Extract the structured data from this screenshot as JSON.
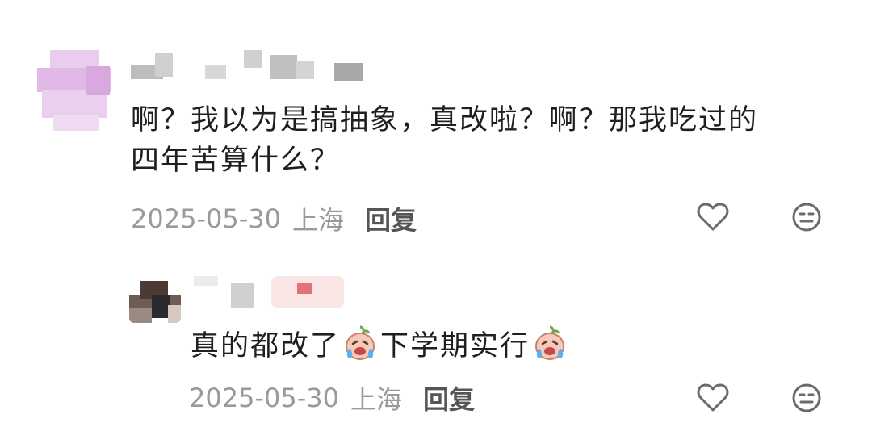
{
  "comments": [
    {
      "text_line1": "啊？我以为是搞抽象，真改啦？啊？那我吃过的",
      "text_line2": "四年苦算什么？",
      "date": "2025-05-30",
      "location": "上海",
      "reply_label": "回复",
      "icons": [
        "heart-icon",
        "neutral-face-icon"
      ]
    },
    {
      "text_part1": "真的都改了",
      "text_part2": "下学期实行",
      "emoji": "crying-face-emoji",
      "date": "2025-05-30",
      "location": "上海",
      "reply_label": "回复",
      "icons": [
        "heart-icon",
        "neutral-face-icon"
      ]
    }
  ],
  "colors": {
    "text": "#1f1f1f",
    "meta": "#9a9a9a",
    "icon": "#6b6b6b",
    "avatar1": "#e6c8ea"
  }
}
